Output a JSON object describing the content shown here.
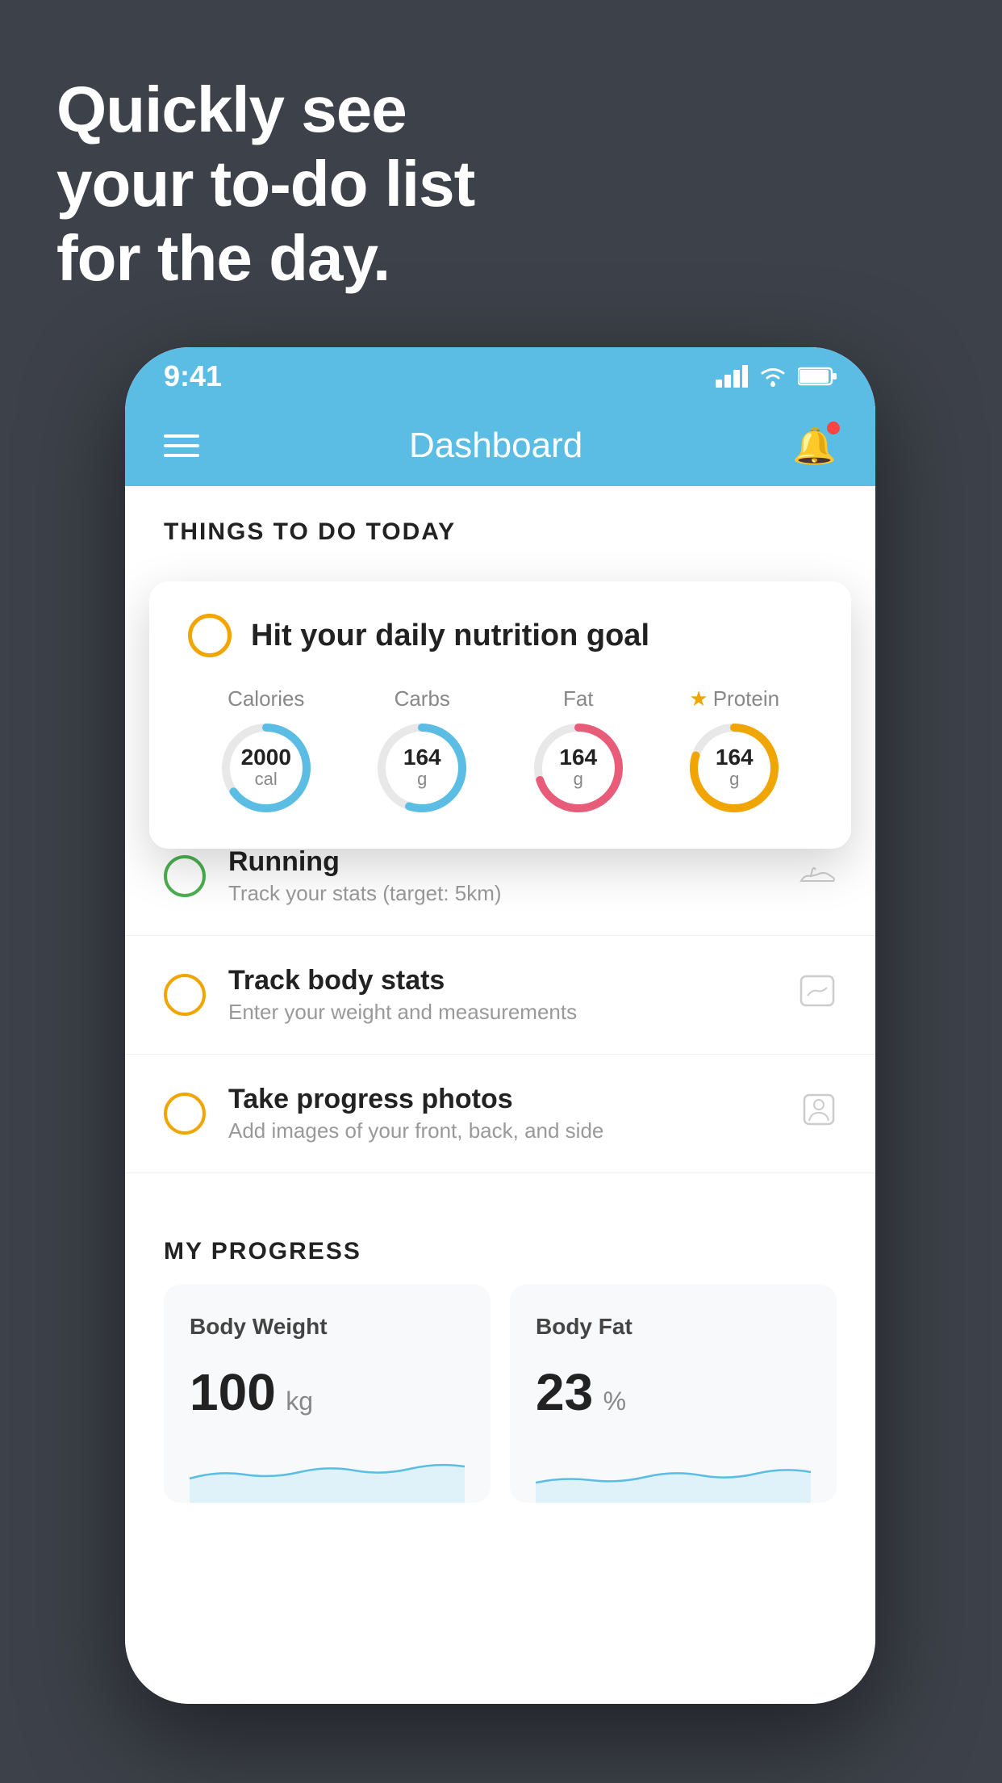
{
  "headline": {
    "line1": "Quickly see",
    "line2": "your to-do list",
    "line3": "for the day."
  },
  "status_bar": {
    "time": "9:41",
    "signal": "▐▐▐▐",
    "wifi": "wifi",
    "battery": "battery"
  },
  "nav": {
    "title": "Dashboard"
  },
  "things_section": {
    "header": "THINGS TO DO TODAY"
  },
  "floating_card": {
    "title": "Hit your daily nutrition goal",
    "macros": [
      {
        "label": "Calories",
        "value": "2000",
        "unit": "cal",
        "color": "#5bbde4",
        "track_color": "#e8e8e8",
        "percent": 65
      },
      {
        "label": "Carbs",
        "value": "164",
        "unit": "g",
        "color": "#5bbde4",
        "track_color": "#e8e8e8",
        "percent": 55
      },
      {
        "label": "Fat",
        "value": "164",
        "unit": "g",
        "color": "#e85c7a",
        "track_color": "#e8e8e8",
        "percent": 70
      },
      {
        "label": "Protein",
        "value": "164",
        "unit": "g",
        "color": "#f0a500",
        "track_color": "#e8e8e8",
        "percent": 80,
        "star": true
      }
    ]
  },
  "list_items": [
    {
      "title": "Running",
      "subtitle": "Track your stats (target: 5km)",
      "check_color": "green",
      "icon": "shoe"
    },
    {
      "title": "Track body stats",
      "subtitle": "Enter your weight and measurements",
      "check_color": "yellow",
      "icon": "scale"
    },
    {
      "title": "Take progress photos",
      "subtitle": "Add images of your front, back, and side",
      "check_color": "yellow",
      "icon": "person"
    }
  ],
  "progress": {
    "header": "MY PROGRESS",
    "cards": [
      {
        "title": "Body Weight",
        "value": "100",
        "unit": "kg"
      },
      {
        "title": "Body Fat",
        "value": "23",
        "unit": "%"
      }
    ]
  }
}
